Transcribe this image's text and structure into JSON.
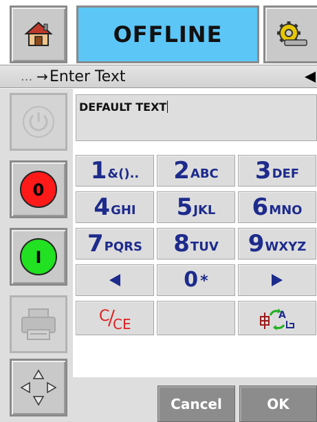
{
  "header": {
    "status": "OFFLINE"
  },
  "breadcrumb": {
    "dots": "...",
    "arrow": "→",
    "title": "Enter Text"
  },
  "side": {
    "stop_label": "0",
    "start_label": "I"
  },
  "text_entry": {
    "value": "DEFAULT TEXT"
  },
  "keypad": {
    "keys": [
      {
        "main": "1",
        "sub": "&()..",
        "icon": "digit-key"
      },
      {
        "main": "2",
        "sub": "ABC",
        "icon": "digit-key"
      },
      {
        "main": "3",
        "sub": "DEF",
        "icon": "digit-key"
      },
      {
        "main": "4",
        "sub": "GHI",
        "icon": "digit-key"
      },
      {
        "main": "5",
        "sub": "JKL",
        "icon": "digit-key"
      },
      {
        "main": "6",
        "sub": "MNO",
        "icon": "digit-key"
      },
      {
        "main": "7",
        "sub": "PQRS",
        "icon": "digit-key"
      },
      {
        "main": "8",
        "sub": "TUV",
        "icon": "digit-key"
      },
      {
        "main": "9",
        "sub": "WXYZ",
        "icon": "digit-key"
      },
      {
        "main": "0",
        "sub": "*"
      }
    ]
  },
  "actions": {
    "cancel": "Cancel",
    "ok": "OK"
  },
  "colors": {
    "status_bg": "#5cc6f7",
    "stop_red": "#ff1a1a",
    "start_green": "#22e022",
    "key_text": "#1d2b8c",
    "clear_red": "#e02020"
  },
  "icons": [
    "home-icon",
    "settings-gear-icon",
    "power-icon",
    "printer-icon",
    "arrows-icon",
    "left-arrow-icon",
    "right-arrow-icon",
    "clear-icon",
    "input-mode-icon"
  ]
}
